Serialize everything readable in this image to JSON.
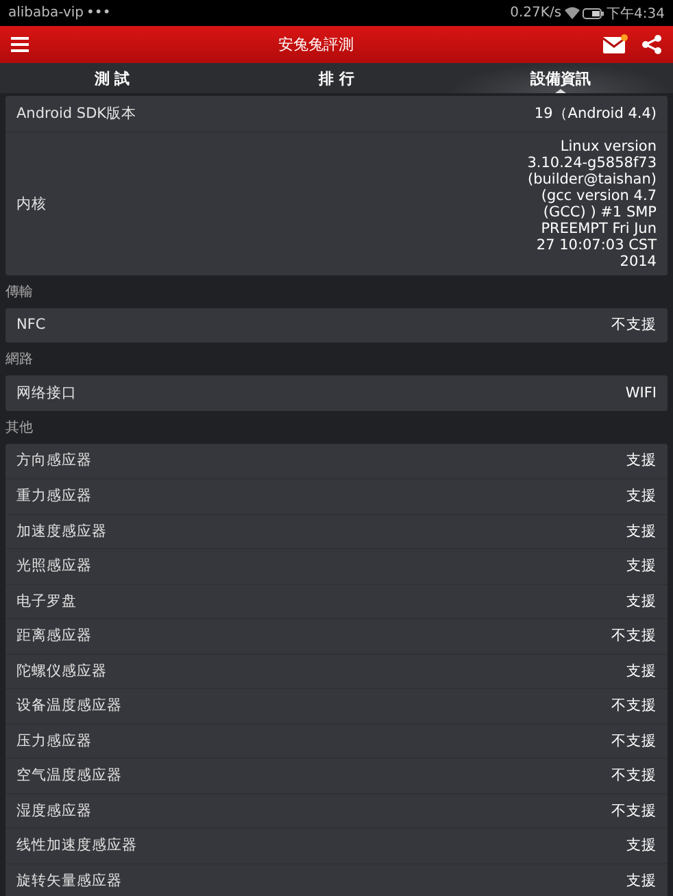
{
  "status_bar": {
    "carrier": "alibaba-vip",
    "dots": "•••",
    "speed": "0.27K/s",
    "time": "下午4:34"
  },
  "app_bar": {
    "title": "安兔兔評測",
    "mail_unread": true
  },
  "tabs": [
    {
      "label": "測 試",
      "selected": false
    },
    {
      "label": "排 行",
      "selected": false
    },
    {
      "label": "設備資訊",
      "selected": true
    }
  ],
  "sections": [
    {
      "rows": [
        {
          "label": "Android SDK版本",
          "value": "19（Android 4.4)"
        },
        {
          "label": "内核",
          "value": "Linux version 3.10.24-g5858f73 (builder@taishan) (gcc version 4.7 (GCC) ) #1 SMP PREEMPT Fri Jun 27 10:07:03 CST 2014"
        }
      ]
    },
    {
      "header": "傳輸",
      "rows": [
        {
          "label": "NFC",
          "value": "不支援"
        }
      ]
    },
    {
      "header": "網路",
      "rows": [
        {
          "label": "网络接口",
          "value": "WIFI"
        }
      ]
    },
    {
      "header": "其他",
      "rows": [
        {
          "label": "方向感应器",
          "value": "支援"
        },
        {
          "label": "重力感应器",
          "value": "支援"
        },
        {
          "label": "加速度感应器",
          "value": "支援"
        },
        {
          "label": "光照感应器",
          "value": "支援"
        },
        {
          "label": "电子罗盘",
          "value": "支援"
        },
        {
          "label": "距离感应器",
          "value": "不支援"
        },
        {
          "label": "陀螺仪感应器",
          "value": "支援"
        },
        {
          "label": "设备温度感应器",
          "value": "不支援"
        },
        {
          "label": "压力感应器",
          "value": "不支援"
        },
        {
          "label": "空气温度感应器",
          "value": "不支援"
        },
        {
          "label": "湿度感应器",
          "value": "不支援"
        },
        {
          "label": "线性加速度感应器",
          "value": "支援"
        },
        {
          "label": "旋转矢量感应器",
          "value": "支援"
        }
      ]
    }
  ]
}
